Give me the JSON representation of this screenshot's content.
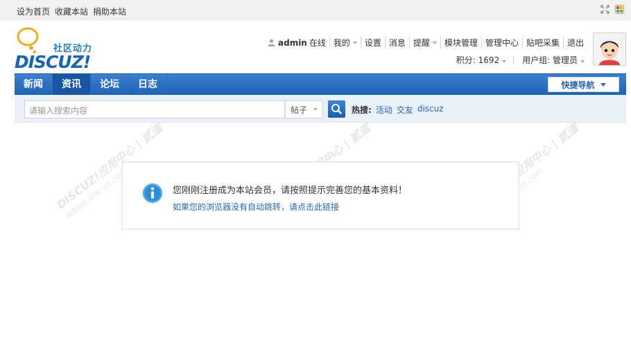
{
  "topbar": {
    "links": [
      "设为首页",
      "收藏本站",
      "捐助本站"
    ],
    "icons": [
      "fullscreen-icon",
      "colorful-app-icon"
    ]
  },
  "logo": {
    "tagline": "社区动力",
    "wordmark": "DISCUZ!"
  },
  "user": {
    "name": "admin",
    "status": "在线",
    "menu": [
      "我的",
      "设置",
      "消息",
      "提醒",
      "模块管理",
      "管理中心",
      "贴吧采集",
      "退出"
    ],
    "credits": "积分: 1692",
    "group": "用户组: 管理员"
  },
  "nav": {
    "tabs": [
      "新闻",
      "资讯",
      "论坛",
      "日志"
    ],
    "active_index": 1,
    "quick_nav": "快捷导航"
  },
  "search": {
    "placeholder": "请输入搜索内容",
    "type": "帖子",
    "hot_label": "热搜:",
    "hot_links": [
      "活动",
      "交友",
      "discuz"
    ]
  },
  "watermark": {
    "line1": "DISCUZ!应用中心 | 贰道",
    "line2": "addon.discuz.com"
  },
  "message": {
    "text": "您刚刚注册成为本站会员，请按照提示完善您的基本资料！",
    "link": "如果您的浏览器没有自动跳转，请点击此链接"
  },
  "colors": {
    "nav_blue": "#1f63b5",
    "link_blue": "#2a64ad",
    "search_bg": "#e9f0f8"
  }
}
